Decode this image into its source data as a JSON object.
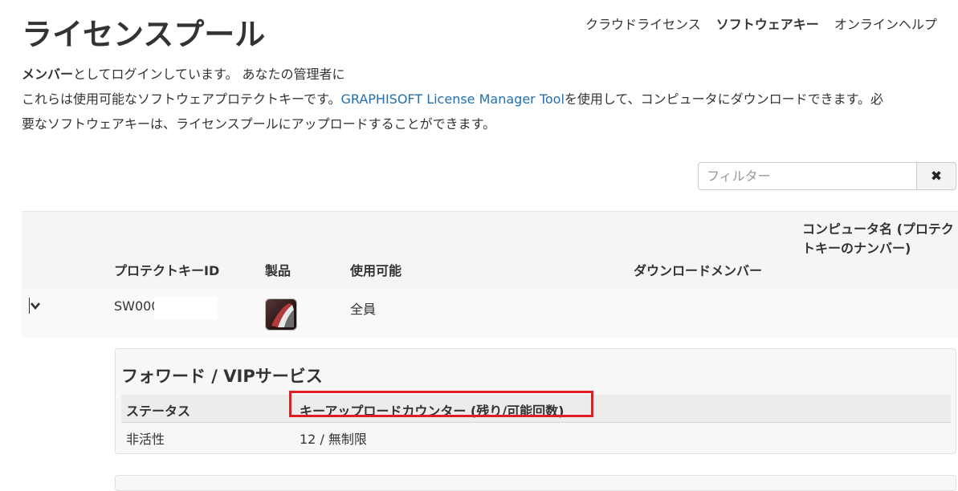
{
  "page": {
    "title": "ライセンスプール"
  },
  "nav": {
    "items": [
      {
        "label": "クラウドライセンス",
        "active": false
      },
      {
        "label": "ソフトウェアキー",
        "active": true
      },
      {
        "label": "オンラインヘルプ",
        "active": false
      }
    ]
  },
  "intro": {
    "role": "メンバー",
    "line1_rest": "としてログインしています。 あなたの管理者に",
    "line2_before": "これらは使用可能なソフトウェアプロテクトキーです。",
    "line2_link": "GRAPHISOFT License Manager Tool",
    "line2_after": "を使用して、コンピュータにダウンロードできます。必",
    "line3": "要なソフトウェアキーは、ライセンスプールにアップロードすることができます。"
  },
  "filter": {
    "placeholder": "フィルター",
    "clear_label": "✖"
  },
  "table": {
    "headers": {
      "protect_key_id": "プロテクトキーID",
      "product": "製品",
      "availability": "使用可能",
      "download_member": "ダウンロードメンバー",
      "computer_name": "コンピュータ名 (プロテクトキーのナンバー)"
    },
    "rows": [
      {
        "expand_icon": "chevron-down-icon",
        "protect_key_id": "SW000",
        "product_icon": "archicad-icon",
        "availability": "全員",
        "download_member": "",
        "computer_name": ""
      }
    ]
  },
  "details": {
    "title": "フォワード / VIPサービス",
    "headers": {
      "status": "ステータス",
      "counter": "キーアップロードカウンター (残り/可能回数)"
    },
    "row": {
      "status": "非活性",
      "counter": "12 / 無制限"
    }
  },
  "colors": {
    "link": "#1f6fb2",
    "highlight": "#e31b23",
    "header_bg": "#f5f5f5"
  }
}
